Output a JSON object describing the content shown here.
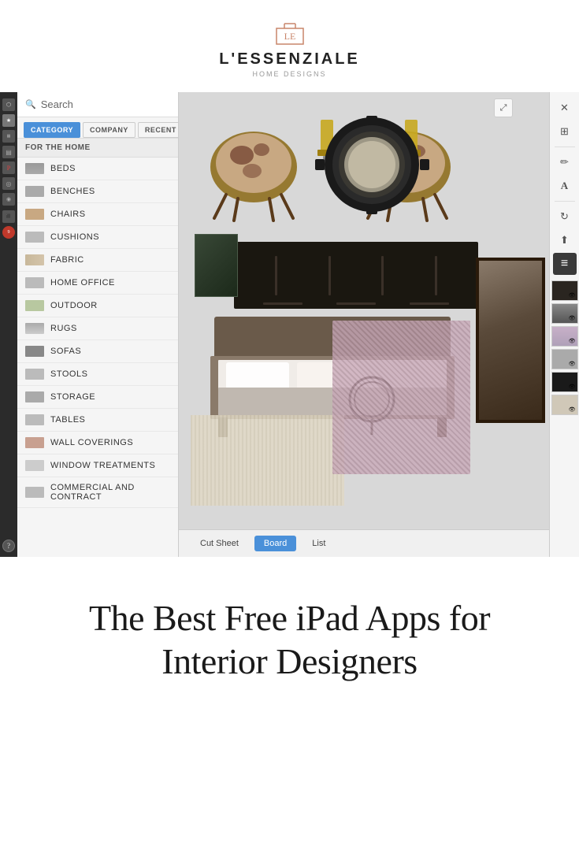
{
  "header": {
    "logo_text": "L'ESSENZIALE",
    "logo_subtitle": "Home Designs"
  },
  "search": {
    "placeholder": "Search"
  },
  "tabs": {
    "category": "CATEGORY",
    "company": "COMPANY",
    "recent": "RECENT",
    "active": "category"
  },
  "section_label": "FOR THE HOME",
  "categories": [
    {
      "id": "beds",
      "label": "BEDS",
      "icon": "beds"
    },
    {
      "id": "benches",
      "label": "BENCHES",
      "icon": "benches"
    },
    {
      "id": "chairs",
      "label": "CHAIRS",
      "icon": "chairs"
    },
    {
      "id": "cushions",
      "label": "CUSHIONS",
      "icon": "cushions"
    },
    {
      "id": "fabric",
      "label": "FABRIC",
      "icon": "fabric"
    },
    {
      "id": "homeoffice",
      "label": "HOME OFFICE",
      "icon": "homeoffice"
    },
    {
      "id": "outdoor",
      "label": "OUTDOOR",
      "icon": "outdoor"
    },
    {
      "id": "rugs",
      "label": "RUGS",
      "icon": "rugs"
    },
    {
      "id": "sofas",
      "label": "SOFAS",
      "icon": "sofas"
    },
    {
      "id": "stools",
      "label": "STOOLS",
      "icon": "stools"
    },
    {
      "id": "storage",
      "label": "STORAGE",
      "icon": "storage"
    },
    {
      "id": "tables",
      "label": "TABLES",
      "icon": "tables"
    },
    {
      "id": "wallcoverings",
      "label": "WALL COVERINGS",
      "icon": "wallcoverings"
    },
    {
      "id": "windowtreatments",
      "label": "WINDOW TREATMENTS",
      "icon": "windowtreatments"
    },
    {
      "id": "commercial",
      "label": "COMMERCIAL AND CONTRACT",
      "icon": "commercial"
    }
  ],
  "board_tabs": [
    {
      "label": "Cut Sheet",
      "active": false
    },
    {
      "label": "Board",
      "active": true
    },
    {
      "label": "List",
      "active": false
    }
  ],
  "toolbar_buttons": [
    {
      "icon": "✕",
      "label": "close",
      "active": false
    },
    {
      "icon": "⊞",
      "label": "grid",
      "active": false
    },
    {
      "icon": "🖊",
      "label": "pen",
      "active": false
    },
    {
      "icon": "A",
      "label": "text",
      "active": false
    },
    {
      "icon": "↻",
      "label": "rotate",
      "active": false
    },
    {
      "icon": "↑",
      "label": "share",
      "active": false
    },
    {
      "icon": "≡",
      "label": "layers",
      "active": true
    }
  ],
  "article": {
    "title": "The Best Free iPad Apps for Interior Designers"
  },
  "colors": {
    "accent_blue": "#4a90d9",
    "dark_bg": "#2b2b2b",
    "panel_bg": "#f5f5f5",
    "board_bg": "#d8d8d8"
  }
}
